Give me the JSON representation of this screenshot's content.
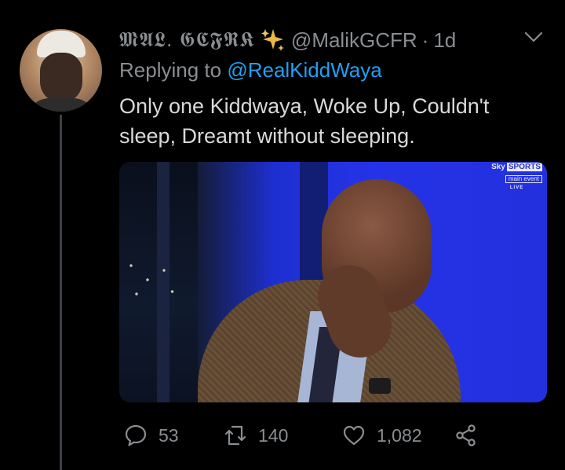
{
  "tweet": {
    "display_name": "𝕸𝕬𝕷. 𝕲𝕮𝕱𝕽𝕶",
    "verified_emoji": "sparkles-icon",
    "handle": "@MalikGCFR",
    "separator": "·",
    "time": "1d",
    "reply_prefix": "Replying to",
    "reply_handle": "@RealKiddWaya",
    "text": "Only one Kiddwaya, Woke Up, Couldn't sleep, Dreamt without sleeping.",
    "media": {
      "badge_brand_1": "Sky",
      "badge_brand_2": "SPORTS",
      "badge_event": "main event",
      "badge_live": "LIVE"
    },
    "actions": {
      "replies": "53",
      "retweets": "140",
      "likes": "1,082"
    }
  },
  "colors": {
    "background": "#000000",
    "muted_text": "#8a8d91",
    "link": "#1da1f2",
    "body_text": "#d9d9d9",
    "sparkle": "#e8b84a"
  }
}
